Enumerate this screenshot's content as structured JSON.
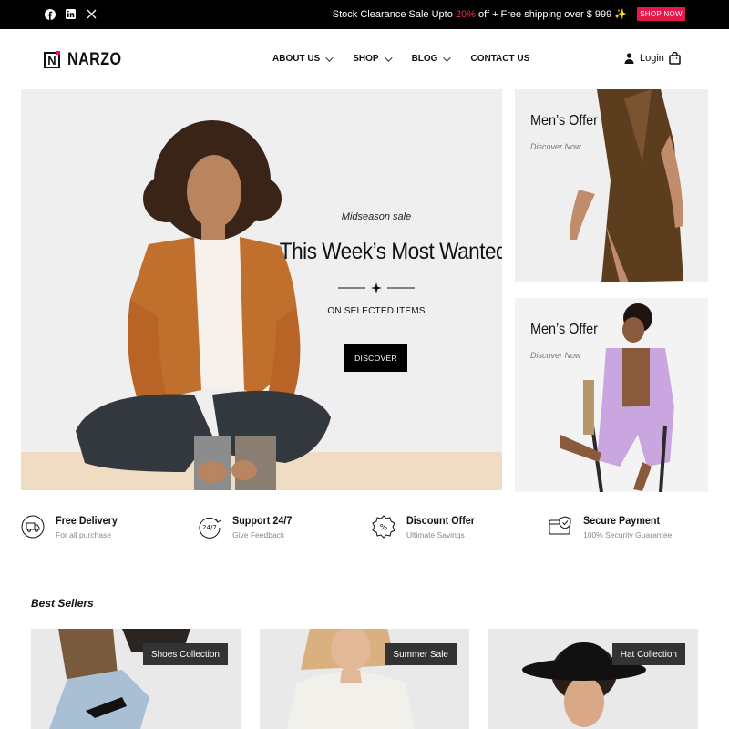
{
  "topbar": {
    "social": [
      {
        "name": "facebook-icon"
      },
      {
        "name": "linkedin-icon"
      },
      {
        "name": "x-icon"
      }
    ],
    "promo_before": "Stock Clearance Sale Upto ",
    "promo_percent": "20%",
    "promo_after": " off + Free shipping over $ 999 ✨",
    "shop_now": "SHOP NOW",
    "accent_color": "#e4184a"
  },
  "header": {
    "logo_letter": "N",
    "logo_text": "NARZO",
    "nav": [
      {
        "label": "ABOUT US",
        "has_dropdown": true
      },
      {
        "label": "SHOP",
        "has_dropdown": true
      },
      {
        "label": "BLOG",
        "has_dropdown": true
      },
      {
        "label": "CONTACT US",
        "has_dropdown": false
      }
    ],
    "login": "Login"
  },
  "hero": {
    "kicker": "Midseason sale",
    "title": "This Week’s Most Wanted",
    "subtitle": "ON SELECTED ITEMS",
    "button": "DISCOVER"
  },
  "banners": [
    {
      "title": "Men’s Offer",
      "link": "Discover Now"
    },
    {
      "title": "Men’s Offer",
      "link": "Discover Now"
    }
  ],
  "features": [
    {
      "icon": "delivery-truck-icon",
      "title": "Free Delivery",
      "sub": "For all purchase"
    },
    {
      "icon": "support-24-7-icon",
      "title": "Support 24/7",
      "sub": "Give Feedback"
    },
    {
      "icon": "discount-badge-icon",
      "title": "Discount Offer",
      "sub": "Ultimate Savings"
    },
    {
      "icon": "secure-payment-icon",
      "title": "Secure Payment",
      "sub": "100% Security Guarantee"
    }
  ],
  "best_sellers": {
    "title": "Best Sellers",
    "cards": [
      {
        "tag": "Shoes Collection"
      },
      {
        "tag": "Summer Sale"
      },
      {
        "tag": "Hat Collection"
      }
    ]
  }
}
